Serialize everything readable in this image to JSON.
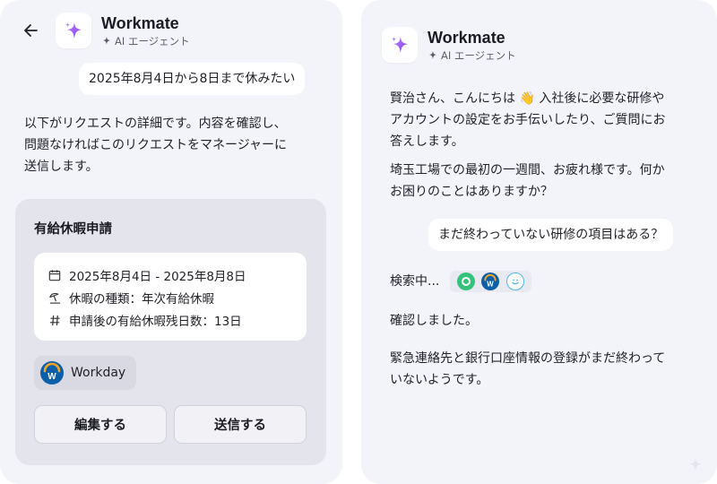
{
  "app": {
    "title": "Workmate",
    "subtitle": "AI エージェント"
  },
  "left": {
    "user_message": "2025年8月4日から8日まで休みたい",
    "assistant_message": "以下がリクエストの詳細です。内容を確認し、問題なければこのリクエストをマネージャーに送信します。",
    "assistant_lines": [
      "以下がリクエストの詳細です。内容を確認し、",
      "問題なければこのリクエストをマネージャーに",
      "送信します。"
    ],
    "card": {
      "title": "有給休暇申請",
      "date_range": "2025年8月4日 - 2025年8月8日",
      "leave_type": "休暇の種類：年次有給休暇",
      "remaining_days": "申請後の有給休暇残日数：13日",
      "integration": "Workday",
      "edit_label": "編集する",
      "submit_label": "送信する"
    }
  },
  "right": {
    "greeting_lines": [
      "賢治さん、こんにちは 👋 入社後に必要な研修や",
      "アカウントの設定をお手伝いしたり、ご質問にお",
      "答えします。"
    ],
    "followup_lines": [
      "埼玉工場での最初の一週間、お疲れ様です。何か",
      "お困りのことはありますか？"
    ],
    "user_message": "まだ終わっていない研修の項目はある？",
    "searching_label": "検索中...",
    "confirmed": "確認しました。",
    "result_lines": [
      "緊急連絡先と銀行口座情報の登録がまだ終わって",
      "いないようです。"
    ]
  },
  "icons": {
    "back": "arrow-left-icon",
    "logo": "sparkle-logo-icon",
    "ai": "sparkle-small-icon",
    "calendar": "calendar-icon",
    "beach": "beach-umbrella-icon",
    "hash": "hash-icon",
    "workday": "workday-logo-icon",
    "sources": [
      "green-circle-app-icon",
      "workday-logo-icon",
      "smile-face-app-icon"
    ]
  },
  "colors": {
    "panel_bg": "#f3f3fa",
    "card_bg": "#e4e4ec",
    "brand_purple": "#8b5cf6",
    "workday_blue": "#0b5ea8",
    "workday_orange": "#f4a524"
  }
}
